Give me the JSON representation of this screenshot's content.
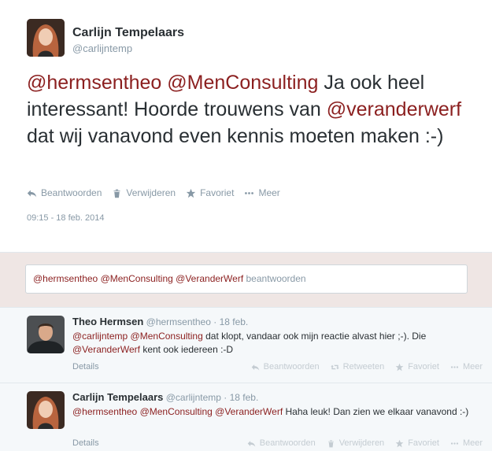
{
  "main_tweet": {
    "name": "Carlijn Tempelaars",
    "handle": "@carlijntemp",
    "text_parts": {
      "m1": "@hermsentheo",
      "m2": "@MenConsulting",
      "t1": " Ja ook heel interessant! Hoorde trouwens van ",
      "m3": "@veranderwerf",
      "t2": " dat wij vanavond even kennis moeten maken :-)"
    },
    "actions": {
      "reply": "Beantwoorden",
      "delete": "Verwijderen",
      "favorite": "Favoriet",
      "more": "Meer"
    },
    "timestamp": "09:15 - 18 feb. 2014"
  },
  "reply_box": {
    "m1": "@hermsentheo",
    "m2": "@MenConsulting",
    "m3": "@VeranderWerf",
    "placeholder": "beantwoorden"
  },
  "replies": [
    {
      "name": "Theo Hermsen",
      "handle": "@hermsentheo",
      "date": "· 18 feb.",
      "text_parts": {
        "m1": "@carlijntemp",
        "m2": "@MenConsulting",
        "t1": " dat klopt, vandaar ook mijn reactie alvast hier ;-). Die ",
        "m3": "@VeranderWerf",
        "t2": " kent ook iedereen :-D"
      },
      "details": "Details",
      "actions": {
        "reply": "Beantwoorden",
        "retweet": "Retweeten",
        "favorite": "Favoriet",
        "more": "Meer"
      }
    },
    {
      "name": "Carlijn Tempelaars",
      "handle": "@carlijntemp",
      "date": "· 18 feb.",
      "text_parts": {
        "m1": "@hermsentheo",
        "m2": "@MenConsulting",
        "m3": "@VeranderWerf",
        "t1": " Haha leuk! Dan zien we elkaar vanavond :-)"
      },
      "details": "Details",
      "actions": {
        "reply": "Beantwoorden",
        "delete": "Verwijderen",
        "favorite": "Favoriet",
        "more": "Meer"
      }
    }
  ],
  "colors": {
    "mention": "#8b1f1f",
    "muted": "#8899a6",
    "reply_area_bg": "#efe6e4"
  }
}
